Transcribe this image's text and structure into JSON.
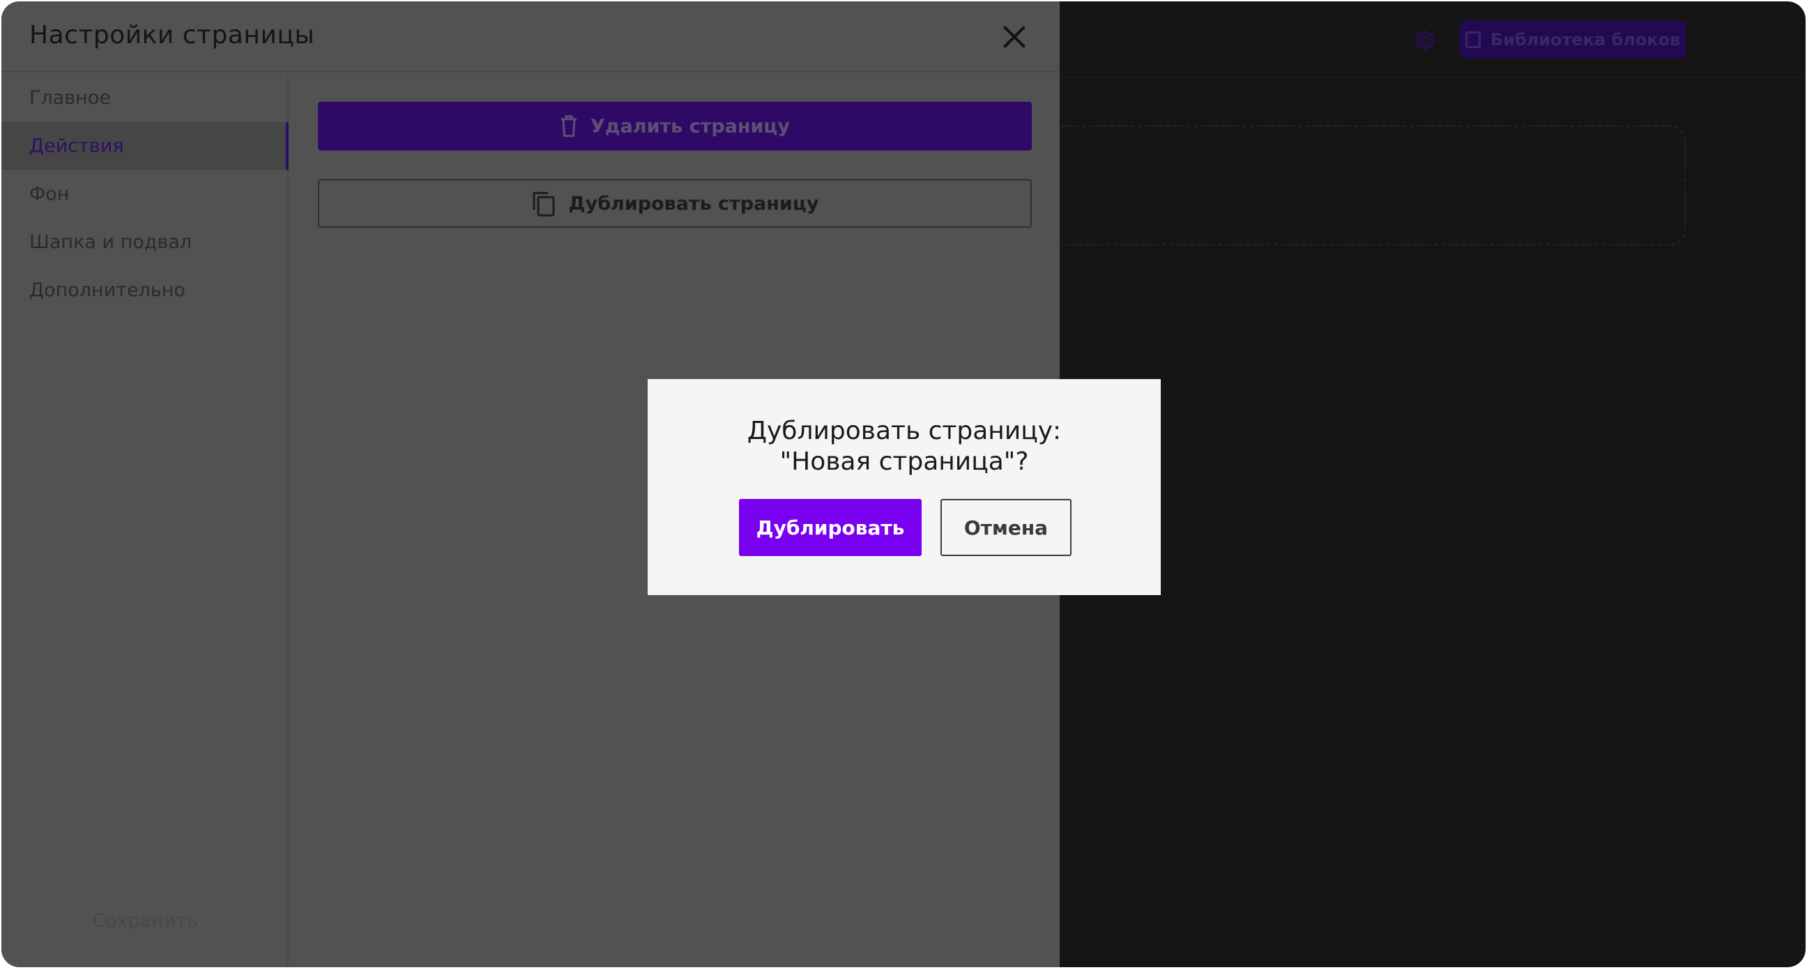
{
  "background_app": {
    "block_library_label": "Библиотека блоков",
    "icons": {
      "settings": "gear-icon",
      "library": "book-icon"
    }
  },
  "settings_panel": {
    "title": "Настройки страницы",
    "nav_items": [
      {
        "label": "Главное",
        "active": false
      },
      {
        "label": "Действия",
        "active": true
      },
      {
        "label": "Фон",
        "active": false
      },
      {
        "label": "Шапка и подвал",
        "active": false
      },
      {
        "label": "Дополнительно",
        "active": false
      }
    ],
    "save_label": "Сохранить",
    "actions": {
      "delete_label": "Удалить страницу",
      "duplicate_label": "Дублировать страницу"
    }
  },
  "dialog": {
    "title_line1": "Дублировать страницу:",
    "title_line2": "\"Новая страница\"?",
    "confirm_label": "Дублировать",
    "cancel_label": "Отмена"
  },
  "colors": {
    "accent": "#7a00f0",
    "panel_bg": "#525252",
    "overlay_bg": "#151515",
    "dialog_bg": "#f5f5f5"
  }
}
